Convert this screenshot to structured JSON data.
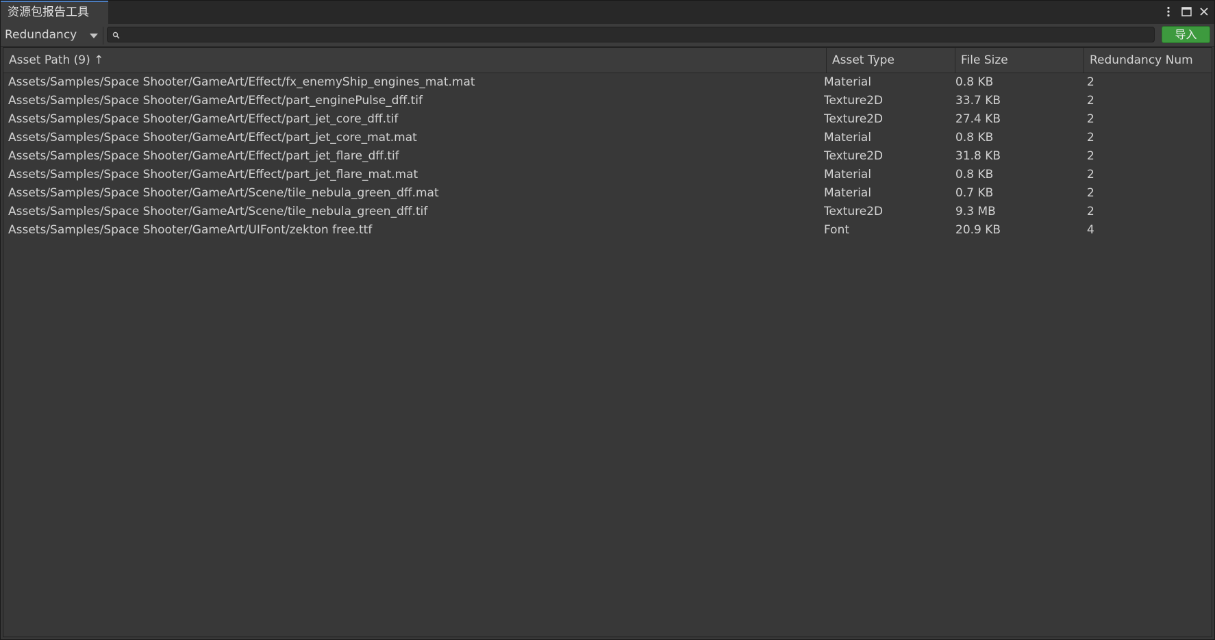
{
  "window": {
    "tab_title": "资源包报告工具"
  },
  "toolbar": {
    "mode_dropdown": "Redundancy",
    "search_value": "",
    "search_placeholder": "",
    "import_label": "导入",
    "import_color": "#3d9a3e"
  },
  "table": {
    "columns": [
      {
        "label": "Asset Path (9) ↑"
      },
      {
        "label": "Asset Type"
      },
      {
        "label": "File Size"
      },
      {
        "label": "Redundancy Num"
      }
    ],
    "rows": [
      {
        "path": "Assets/Samples/Space Shooter/GameArt/Effect/fx_enemyShip_engines_mat.mat",
        "type": "Material",
        "size": "0.8 KB",
        "num": "2"
      },
      {
        "path": "Assets/Samples/Space Shooter/GameArt/Effect/part_enginePulse_dff.tif",
        "type": "Texture2D",
        "size": "33.7 KB",
        "num": "2"
      },
      {
        "path": "Assets/Samples/Space Shooter/GameArt/Effect/part_jet_core_dff.tif",
        "type": "Texture2D",
        "size": "27.4 KB",
        "num": "2"
      },
      {
        "path": "Assets/Samples/Space Shooter/GameArt/Effect/part_jet_core_mat.mat",
        "type": "Material",
        "size": "0.8 KB",
        "num": "2"
      },
      {
        "path": "Assets/Samples/Space Shooter/GameArt/Effect/part_jet_flare_dff.tif",
        "type": "Texture2D",
        "size": "31.8 KB",
        "num": "2"
      },
      {
        "path": "Assets/Samples/Space Shooter/GameArt/Effect/part_jet_flare_mat.mat",
        "type": "Material",
        "size": "0.8 KB",
        "num": "2"
      },
      {
        "path": "Assets/Samples/Space Shooter/GameArt/Scene/tile_nebula_green_dff.mat",
        "type": "Material",
        "size": "0.7 KB",
        "num": "2"
      },
      {
        "path": "Assets/Samples/Space Shooter/GameArt/Scene/tile_nebula_green_dff.tif",
        "type": "Texture2D",
        "size": "9.3 MB",
        "num": "2"
      },
      {
        "path": "Assets/Samples/Space Shooter/GameArt/UIFont/zekton free.ttf",
        "type": "Font",
        "size": "20.9 KB",
        "num": "4"
      }
    ]
  }
}
